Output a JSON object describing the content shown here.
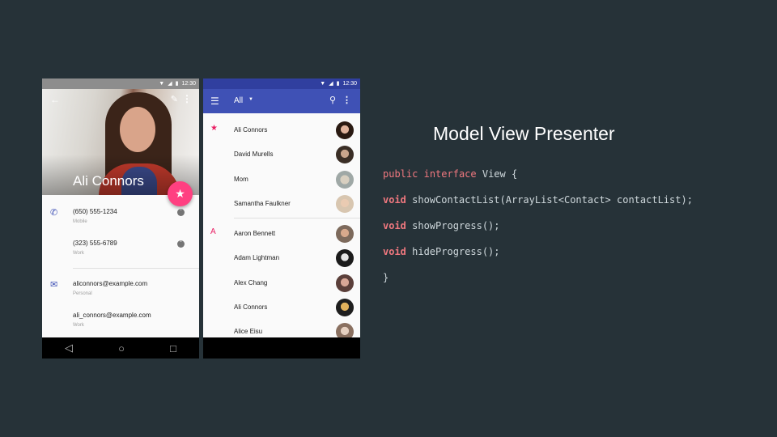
{
  "phone_detail": {
    "status_time": "12:30",
    "contact_name": "Ali Connors",
    "icons": {
      "back": "arrow-back-icon",
      "edit": "pencil-icon",
      "more": "more-vert-icon",
      "favorite": "star-icon"
    },
    "details": [
      {
        "icon": "phone-icon",
        "primary": "(650) 555-1234",
        "secondary": "Mobile",
        "action": "hangouts-icon"
      },
      {
        "icon": "",
        "primary": "(323) 555-6789",
        "secondary": "Work",
        "action": "hangouts-icon"
      },
      {
        "icon": "email-icon",
        "primary": "aliconnors@example.com",
        "secondary": "Personal",
        "action": ""
      },
      {
        "icon": "",
        "primary": "ali_connors@example.com",
        "secondary": "Work",
        "action": ""
      }
    ]
  },
  "phone_list": {
    "status_time": "12:30",
    "toolbar_title": "All",
    "icons": {
      "menu": "hamburger-icon",
      "dropdown": "dropdown-arrow-icon",
      "search": "search-icon",
      "more": "more-vert-icon"
    },
    "starred_contacts": [
      "Ali Connors",
      "David Murells",
      "Mom",
      "Samantha Faulkner"
    ],
    "section_letter": "A",
    "contacts": [
      "Aaron Bennett",
      "Adam Lightman",
      "Alex Chang",
      "Ali Connors",
      "Alice Eisu"
    ],
    "colors": {
      "primary": "#3f51b5",
      "primary_dark": "#303f9f",
      "accent": "#ff4081"
    }
  },
  "slide": {
    "title": "Model View Presenter",
    "code": {
      "line1_kw1": "public",
      "line1_kw2": "interface",
      "line1_rest": " View {",
      "line2_kw": "void",
      "line2_rest": " showContactList(ArrayList<Contact> contactList);",
      "line3_kw": "void",
      "line3_rest": " showProgress();",
      "line4_kw": "void",
      "line4_rest": " hideProgress();",
      "line5": "}"
    }
  }
}
